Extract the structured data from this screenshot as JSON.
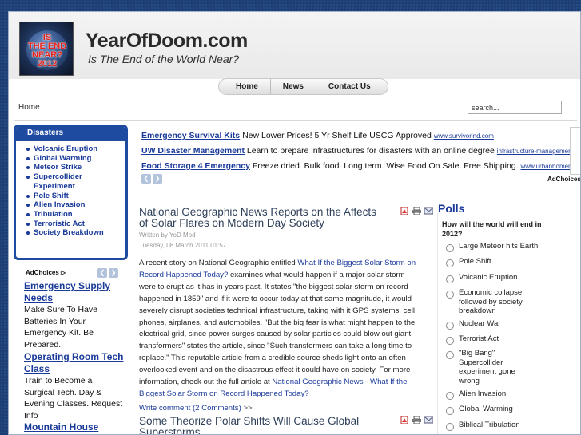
{
  "site": {
    "logo_text": [
      "IS",
      "THE END",
      "NEAR?",
      "2012"
    ],
    "title": "YearOfDoom.com",
    "slogan": "Is The End of the World Near?"
  },
  "nav": [
    "Home",
    "News",
    "Contact Us"
  ],
  "breadcrumb": "Home",
  "search": {
    "placeholder": "search..."
  },
  "disasters": {
    "title": "Disasters",
    "items": [
      "Volcanic Eruption",
      "Global Warming",
      "Meteor Strike",
      "Supercollider Experiment",
      "Pole Shift",
      "Alien Invasion",
      "Tribulation",
      "Terroristic Act",
      "Society Breakdown"
    ]
  },
  "left_ads": {
    "adchoices": "AdChoices",
    "ads": [
      {
        "title": "Emergency Supply Needs",
        "text": "Make Sure To Have Batteries In Your Emergency Kit. Be Prepared."
      },
      {
        "title": "Operating Room Tech Class",
        "text": "Train to Become a Surgical Tech. Day & Evening Classes. Request Info"
      },
      {
        "title": "Mountain House",
        "text": ""
      }
    ]
  },
  "top_ads": [
    {
      "title": "Emergency Survival Kits",
      "text": "New Lower Prices! 5 Yr Shelf Life USCG Approved",
      "url": "www.survivorind.com"
    },
    {
      "title": "UW Disaster Management",
      "text": "Learn to prepare infrastructures for disasters with an online degree",
      "url": "infrastructure-management.uw.edu"
    },
    {
      "title": "Food Storage 4 Emergency",
      "text": "Freeze dried. Bulk food. Long term. Wise Food On Sale. Free Shipping.",
      "url": "www.urbanhomemaker.com"
    }
  ],
  "adchoices_right": "AdChoices",
  "articles": [
    {
      "title": "National Geographic News Reports on the Affects of Solar Flares on Modern Day Society",
      "author": "Written by YoD Mod",
      "date": "Tuesday, 08 March 2011 01:57",
      "body_1": "A recent story on National Geographic entitled ",
      "link_1": "What If the Biggest Solar Storm on Record Happened Today?",
      "body_2": " examines what would happen if a major solar storm were to erupt as it has in years past. It states \"the biggest solar storm on record happened in 1859\" and if it were to occur today at that same magnitude, it would severely disrupt societies technical infrastructure, taking with it GPS systems, cell phones, airplanes, and automobiles.  \"But the big fear is what might happen to the electrical grid, since power surges caused by solar particles could blow out giant transformers\" states the article, since \"Such transformers can take a long time to replace.\"  This reputable article from a credible source sheds light onto an often overlooked event and on the disastrous effect it could have on society.  For more information, check out the full article at ",
      "link_2": "National Geographic News - What If the Biggest Solar Storm on Record Happened Today?",
      "comment": "Write comment (2 Comments)",
      "comment_arrow": ">>"
    },
    {
      "title": "Some Theorize Polar Shifts Will Cause Global Superstorms"
    }
  ],
  "polls": {
    "title": "Polls",
    "question": "How will the world will end in 2012?",
    "options": [
      "Large Meteor hits Earth",
      "Pole Shift",
      "Volcanic Eruption",
      "Economic collapse followed by society breakdown",
      "Nuclear War",
      "Terrorist Act",
      "\"Big Bang\" Supercollider experiment gone wrong",
      "Alien Invasion",
      "Global Warming",
      "Biblical Tribulation"
    ]
  }
}
